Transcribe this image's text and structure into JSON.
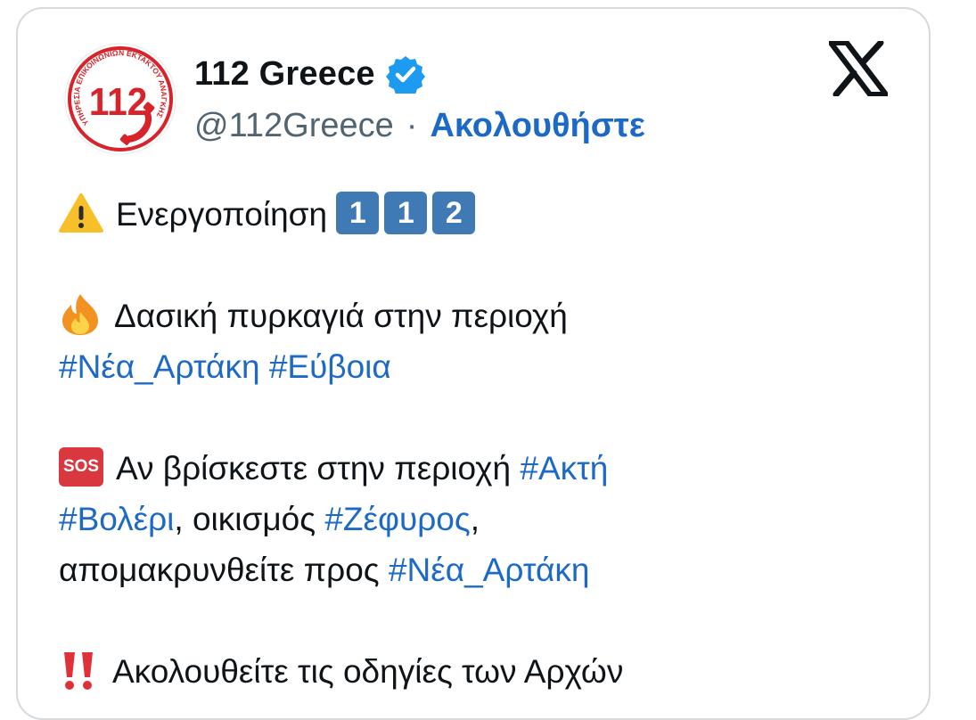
{
  "account": {
    "display_name": "112 Greece",
    "handle": "@112Greece",
    "separator": "·",
    "follow_label": "Ακολουθήστε",
    "verified": true,
    "avatar": {
      "number": "112",
      "ring_text": "ΥΠΗΡΕΣΙΑ ΕΠΙΚΟΙΝΩΝΙΩΝ ΕΚΤΑΚΤΟΥ ΑΝΑΓΚΗΣ",
      "brand_color": "#d8232a"
    }
  },
  "platform_icon": "x-logo-icon",
  "colors": {
    "link": "#1d69c7",
    "text": "#0f1419",
    "muted": "#536471",
    "verified": "#1d9bf0"
  },
  "tweet": {
    "line1": {
      "emoji": "warning-icon",
      "text": "Ενεργοποίηση",
      "keycaps": [
        "1",
        "1",
        "2"
      ]
    },
    "line2": {
      "emoji": "fire-icon",
      "text": "Δασική πυρκαγιά στην περιοχή",
      "tag1": "#Νέα_Αρτάκη",
      "tag2": "#Εύβοια"
    },
    "line3": {
      "emoji_label": "SOS",
      "text1": "Αν βρίσκεστε στην περιοχή",
      "tag1": "#Ακτή",
      "tag2": "#Βολέρι",
      "text2": ", οικισμός",
      "tag3": "#Ζέφυρος",
      "text3": ",",
      "text4": "απομακρυνθείτε προς",
      "tag4": "#Νέα_Αρτάκη"
    },
    "line4": {
      "emoji": "double-exclamation-icon",
      "text": "Ακολουθείτε τις οδηγίες των Αρχών"
    }
  }
}
